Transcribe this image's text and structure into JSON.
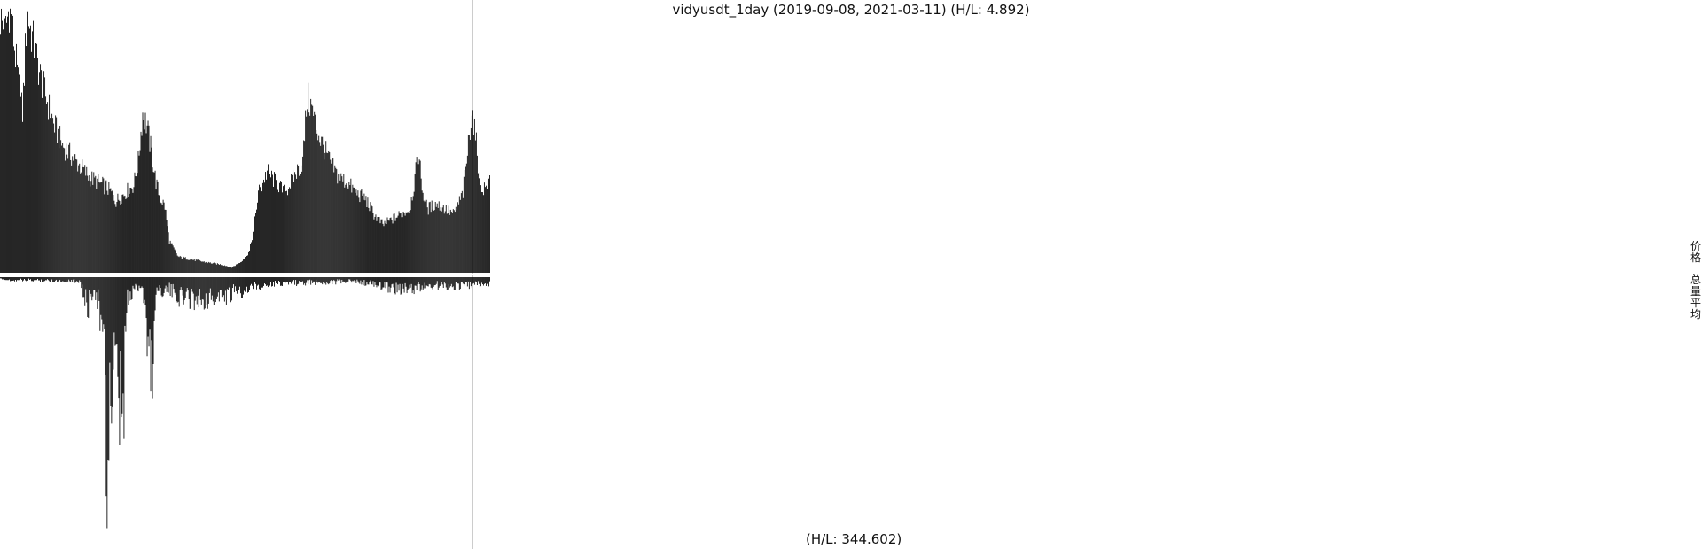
{
  "chart_data": {
    "type": "bar",
    "title": "vidyusdt_1day (2019-09-08, 2021-03-11) (H/L: 4.892)",
    "subtitle": "(H/L: 344.602)",
    "legend": [
      "价格",
      "总量平均"
    ],
    "legend_placement": "right",
    "x_start": "2019-09-08",
    "x_end": "2021-03-11",
    "grid": false,
    "colors": {
      "bars": "#000000",
      "divider": "#cccccc",
      "background": "#ffffff"
    },
    "series": [
      {
        "name": "价格",
        "keypoints": [
          [
            0,
            0.96
          ],
          [
            5,
            0.9
          ],
          [
            10,
            1.0
          ],
          [
            15,
            0.88
          ],
          [
            20,
            0.72
          ],
          [
            25,
            0.6
          ],
          [
            30,
            0.99
          ],
          [
            35,
            0.9
          ],
          [
            40,
            0.82
          ],
          [
            45,
            0.74
          ],
          [
            50,
            0.68
          ],
          [
            55,
            0.62
          ],
          [
            60,
            0.56
          ],
          [
            65,
            0.52
          ],
          [
            70,
            0.48
          ],
          [
            75,
            0.46
          ],
          [
            80,
            0.44
          ],
          [
            90,
            0.4
          ],
          [
            100,
            0.36
          ],
          [
            110,
            0.34
          ],
          [
            120,
            0.32
          ],
          [
            125,
            0.3
          ],
          [
            130,
            0.27
          ],
          [
            140,
            0.3
          ],
          [
            150,
            0.33
          ],
          [
            155,
            0.42
          ],
          [
            160,
            0.6
          ],
          [
            165,
            0.55
          ],
          [
            170,
            0.45
          ],
          [
            175,
            0.34
          ],
          [
            180,
            0.28
          ],
          [
            185,
            0.25
          ],
          [
            190,
            0.12
          ],
          [
            200,
            0.06
          ],
          [
            215,
            0.05
          ],
          [
            230,
            0.04
          ],
          [
            250,
            0.03
          ],
          [
            260,
            0.02
          ],
          [
            270,
            0.04
          ],
          [
            280,
            0.08
          ],
          [
            285,
            0.17
          ],
          [
            290,
            0.3
          ],
          [
            300,
            0.38
          ],
          [
            310,
            0.34
          ],
          [
            320,
            0.3
          ],
          [
            330,
            0.36
          ],
          [
            340,
            0.42
          ],
          [
            345,
            0.66
          ],
          [
            350,
            0.62
          ],
          [
            355,
            0.55
          ],
          [
            360,
            0.5
          ],
          [
            370,
            0.42
          ],
          [
            380,
            0.36
          ],
          [
            390,
            0.34
          ],
          [
            400,
            0.3
          ],
          [
            410,
            0.28
          ],
          [
            420,
            0.22
          ],
          [
            430,
            0.18
          ],
          [
            440,
            0.2
          ],
          [
            450,
            0.22
          ],
          [
            460,
            0.24
          ],
          [
            465,
            0.33
          ],
          [
            470,
            0.45
          ],
          [
            475,
            0.3
          ],
          [
            480,
            0.24
          ],
          [
            490,
            0.26
          ],
          [
            500,
            0.24
          ],
          [
            510,
            0.22
          ],
          [
            520,
            0.3
          ],
          [
            525,
            0.45
          ],
          [
            530,
            0.62
          ],
          [
            535,
            0.48
          ],
          [
            540,
            0.32
          ],
          [
            545,
            0.32
          ],
          [
            550,
            0.36
          ]
        ]
      },
      {
        "name": "总量平均",
        "keypoints": [
          [
            0,
            0.012
          ],
          [
            90,
            0.018
          ],
          [
            95,
            0.12
          ],
          [
            100,
            0.13
          ],
          [
            105,
            0.04
          ],
          [
            110,
            0.12
          ],
          [
            115,
            0.28
          ],
          [
            118,
            0.55
          ],
          [
            120,
            1.0
          ],
          [
            123,
            0.5
          ],
          [
            125,
            0.62
          ],
          [
            128,
            0.45
          ],
          [
            130,
            0.36
          ],
          [
            132,
            0.88
          ],
          [
            135,
            0.55
          ],
          [
            138,
            0.85
          ],
          [
            140,
            0.3
          ],
          [
            143,
            0.12
          ],
          [
            148,
            0.08
          ],
          [
            150,
            0.05
          ],
          [
            160,
            0.04
          ],
          [
            170,
            0.48
          ],
          [
            175,
            0.06
          ],
          [
            190,
            0.06
          ],
          [
            200,
            0.09
          ],
          [
            220,
            0.1
          ],
          [
            240,
            0.1
          ],
          [
            260,
            0.08
          ],
          [
            280,
            0.05
          ],
          [
            300,
            0.03
          ],
          [
            400,
            0.02
          ],
          [
            440,
            0.05
          ],
          [
            460,
            0.06
          ],
          [
            480,
            0.04
          ],
          [
            520,
            0.04
          ],
          [
            550,
            0.03
          ]
        ]
      }
    ]
  }
}
